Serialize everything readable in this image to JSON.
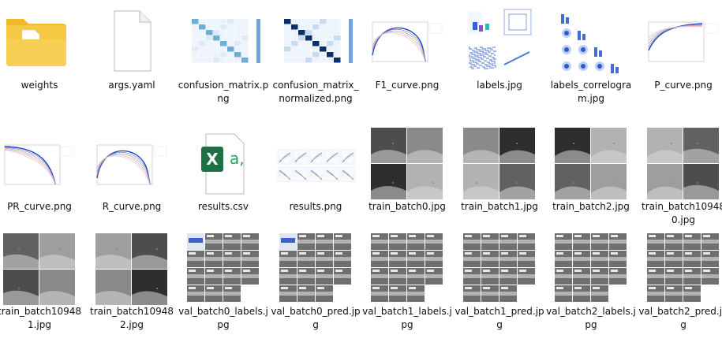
{
  "files": [
    {
      "label": "weights",
      "icon": "folder-icon",
      "kind": "folder"
    },
    {
      "label": "args.yaml",
      "icon": "document-icon",
      "kind": "doc"
    },
    {
      "label": "confusion_matrix.png",
      "icon": "confusion-matrix-thumbnail",
      "kind": "cm"
    },
    {
      "label": "confusion_matrix_normalized.png",
      "icon": "confusion-matrix-normalized-thumbnail",
      "kind": "cmn"
    },
    {
      "label": "F1_curve.png",
      "icon": "f1-curve-thumbnail",
      "kind": "curve"
    },
    {
      "label": "labels.jpg",
      "icon": "labels-thumbnail",
      "kind": "labels"
    },
    {
      "label": "labels_correlogram.jpg",
      "icon": "labels-correlogram-thumbnail",
      "kind": "corr"
    },
    {
      "label": "P_curve.png",
      "icon": "p-curve-thumbnail",
      "kind": "curve2"
    },
    {
      "label": "PR_curve.png",
      "icon": "pr-curve-thumbnail",
      "kind": "curve3"
    },
    {
      "label": "R_curve.png",
      "icon": "r-curve-thumbnail",
      "kind": "curve"
    },
    {
      "label": "results.csv",
      "icon": "excel-icon",
      "kind": "excel"
    },
    {
      "label": "results.png",
      "icon": "results-thumbnail",
      "kind": "results"
    },
    {
      "label": "train_batch0.jpg",
      "icon": "train-batch-thumbnail",
      "kind": "batch"
    },
    {
      "label": "train_batch1.jpg",
      "icon": "train-batch-thumbnail",
      "kind": "batch"
    },
    {
      "label": "train_batch2.jpg",
      "icon": "train-batch-thumbnail",
      "kind": "batch"
    },
    {
      "label": "train_batch109480.jpg",
      "icon": "train-batch-thumbnail",
      "kind": "batch"
    },
    {
      "label": "train_batch109481.jpg",
      "icon": "train-batch-thumbnail",
      "kind": "batch"
    },
    {
      "label": "train_batch109482.jpg",
      "icon": "train-batch-thumbnail",
      "kind": "batch"
    },
    {
      "label": "val_batch0_labels.jpg",
      "icon": "val-batch-thumbnail",
      "kind": "val"
    },
    {
      "label": "val_batch0_pred.jpg",
      "icon": "val-batch-thumbnail",
      "kind": "val"
    },
    {
      "label": "val_batch1_labels.jpg",
      "icon": "val-batch-thumbnail",
      "kind": "val"
    },
    {
      "label": "val_batch1_pred.jpg",
      "icon": "val-batch-thumbnail",
      "kind": "val"
    },
    {
      "label": "val_batch2_labels.jpg",
      "icon": "val-batch-thumbnail",
      "kind": "val"
    },
    {
      "label": "val_batch2_pred.jpg",
      "icon": "val-batch-thumbnail",
      "kind": "val"
    }
  ]
}
